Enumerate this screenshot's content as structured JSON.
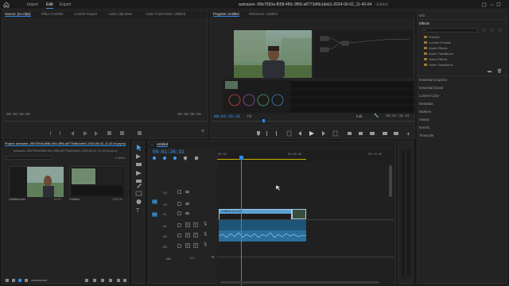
{
  "topbar": {
    "menus": [
      "Import",
      "Edit",
      "Export"
    ],
    "active_menu": "Edit",
    "project_title": "autosave--05b7593a-f658-4f0c-3f56-a8773d6b1deb1-2024-06-02_11-43-04",
    "edited_label": "- Edited"
  },
  "source_panel": {
    "tabs": [
      "Source: (no clips)",
      "Effect Controls",
      "Lumetri Scopes",
      "Audio Clip Mixer",
      "Audio Track Mixer: Untitled"
    ],
    "timecode_left": "00:00:00:00",
    "timecode_right": "00:00:00:00"
  },
  "program_panel": {
    "tabs": [
      "Program: Untitled",
      "Reference: Untitled"
    ],
    "timecode": "00:01:26:31",
    "fit_label": "Fit",
    "quality_label": "Full",
    "duration": "00:01:38:34"
  },
  "right_panel": {
    "info_label": "Info",
    "effects_label": "Effects",
    "search_placeholder": "",
    "effect_folders": [
      "Presets",
      "Lumetri Presets",
      "Audio Effects",
      "Audio Transitions",
      "Video Effects",
      "Video Transitions"
    ],
    "sections": [
      "Essential Graphics",
      "Essential Sound",
      "Lumetri Color",
      "Metadata",
      "Markers",
      "History",
      "Events",
      "Timecode"
    ]
  },
  "project_panel": {
    "tab": "Project: autosave--05b7593a-f658-4f0c-3f56-a8773d6b1deb1-2024-06-02_11-43-04.prproj",
    "path": "autosave--05b7593a-f658-4f0c-3f56-a8773d6b1deb1-2024-06-02_11-43-04.prproj",
    "items_count": "2 items",
    "items": [
      {
        "name": "Untitled.mov",
        "duration": "14:33"
      },
      {
        "name": "Untitled",
        "duration": "1:38:34"
      }
    ]
  },
  "timeline": {
    "tab": "Untitled",
    "timecode": "00:01:26:31",
    "ruler": [
      "00:00",
      "00:05:00",
      "00:10:00"
    ],
    "video_tracks": [
      "V3",
      "V2",
      "V1"
    ],
    "audio_tracks": [
      "A1",
      "A2",
      "A3"
    ],
    "clip_label": "Untitled.mov [V]",
    "mix_label": "Mix",
    "mix_value": "0.0",
    "track_toggles": {
      "mute": "M",
      "solo": "S"
    }
  },
  "colors": {
    "accent": "#2d8ceb",
    "video_clip": "#5ea0d0",
    "audio_clip": "#2a6f9e",
    "playhead": "#2d8ceb"
  }
}
